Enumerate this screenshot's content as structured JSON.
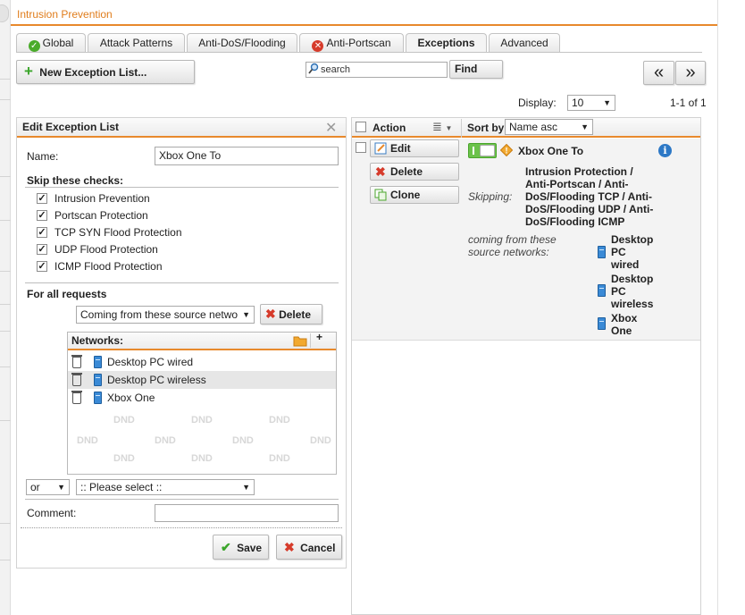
{
  "app": {
    "title": "Intrusion Prevention"
  },
  "tabs": [
    {
      "label": "Global",
      "status": "ok"
    },
    {
      "label": "Attack Patterns"
    },
    {
      "label": "Anti-DoS/Flooding"
    },
    {
      "label": "Anti-Portscan",
      "status": "error"
    },
    {
      "label": "Exceptions",
      "active": true
    },
    {
      "label": "Advanced"
    }
  ],
  "toolbar": {
    "new_list_label": "New Exception List...",
    "search_placeholder": "search",
    "find_label": "Find",
    "prev_page": "«",
    "next_page": "»",
    "display_label": "Display:",
    "display_value": "10",
    "page_range": "1-1 of 1"
  },
  "edit_panel": {
    "title": "Edit Exception List",
    "name_label": "Name:",
    "name_value": "Xbox One To",
    "skip_label": "Skip these checks:",
    "checks": [
      {
        "label": "Intrusion Prevention",
        "checked": true
      },
      {
        "label": "Portscan Protection",
        "checked": true
      },
      {
        "label": "TCP SYN Flood Protection",
        "checked": true
      },
      {
        "label": "UDP Flood Protection",
        "checked": true
      },
      {
        "label": "ICMP Flood Protection",
        "checked": true
      }
    ],
    "for_all_label": "For all requests",
    "condition_select": "Coming from these source netwo",
    "delete_label": "Delete",
    "networks_label": "Networks:",
    "networks": [
      {
        "name": "Desktop PC wired"
      },
      {
        "name": "Desktop PC wireless",
        "selected": true
      },
      {
        "name": "Xbox One"
      }
    ],
    "dnd_text": "DND",
    "or_select": "or",
    "please_select": ":: Please select ::",
    "comment_label": "Comment:",
    "comment_value": "",
    "save_label": "Save",
    "cancel_label": "Cancel"
  },
  "list_panel": {
    "action_label": "Action",
    "sort_label": "Sort by:",
    "sort_value": "Name asc",
    "edit_label": "Edit",
    "delete_label": "Delete",
    "clone_label": "Clone",
    "item": {
      "name": "Xbox One To",
      "enabled": true,
      "skipping_label": "Skipping:",
      "skipping_lines": [
        "Intrusion Protection /",
        "Anti-Portscan / Anti-",
        "DoS/Flooding TCP / Anti-",
        "DoS/Flooding UDP / Anti-",
        "DoS/Flooding ICMP"
      ],
      "source_label_lines": [
        "coming from these",
        "source networks:"
      ],
      "source_networks": [
        {
          "lines": [
            "Desktop",
            "PC",
            "wired"
          ]
        },
        {
          "lines": [
            "Desktop",
            "PC",
            "wireless"
          ]
        },
        {
          "lines": [
            "Xbox",
            "One"
          ]
        }
      ]
    }
  },
  "colors": {
    "accent": "#e8892c",
    "ok": "#4aab2a",
    "error": "#d63b2b",
    "info": "#2c78c6"
  }
}
